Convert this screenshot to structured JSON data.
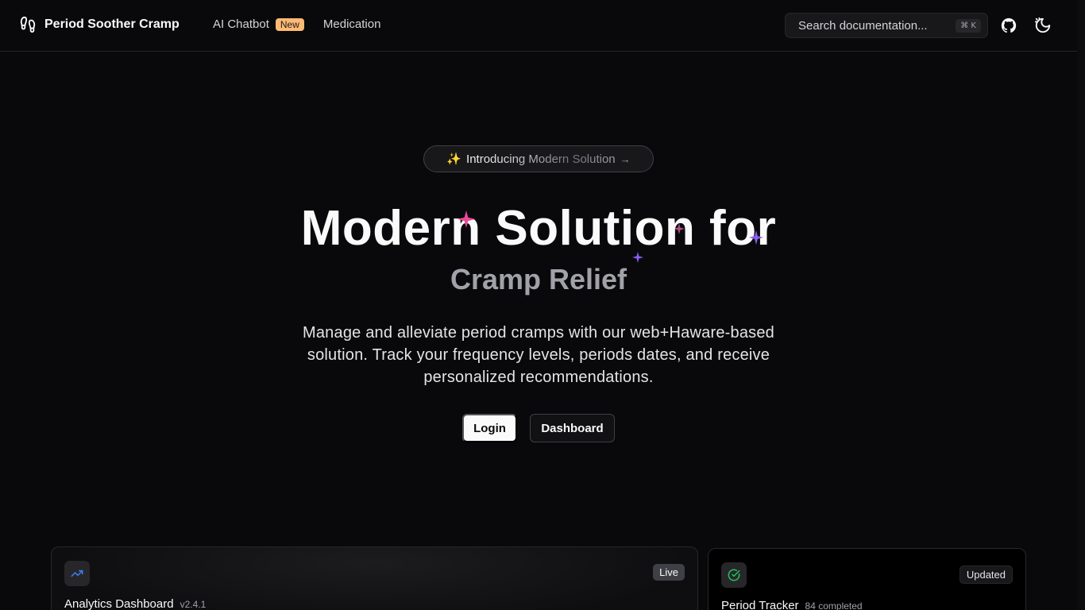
{
  "header": {
    "brand": "Period Soother Cramp",
    "nav": [
      {
        "label": "AI Chatbot",
        "badge": "New"
      },
      {
        "label": "Medication"
      }
    ],
    "search": {
      "placeholder": "Search documentation...",
      "shortcut": "⌘ K"
    },
    "icons": [
      "github-icon",
      "theme-toggle-icon"
    ]
  },
  "hero": {
    "announcement": {
      "emoji": "✨",
      "text": "Introducing Modern Solution",
      "arrow": "→"
    },
    "title": "Modern Solution for",
    "subtitle": "Cramp Relief",
    "description": "Manage and alleviate period cramps with our web+Haware-based solution. Track your frequency levels, periods dates, and receive personalized recommendations.",
    "buttons": {
      "login": "Login",
      "dashboard": "Dashboard"
    }
  },
  "cards": [
    {
      "title": "Analytics Dashboard",
      "meta": "v2.4.1",
      "tag": "Live",
      "icon": "trend-up-icon"
    },
    {
      "title": "Period Tracker",
      "meta": "84 completed",
      "tag": "Updated",
      "icon": "check-circle-icon"
    }
  ],
  "colors": {
    "background": "#09090b",
    "badge": "#fdba74",
    "accent_blue": "#3b82f6",
    "accent_green": "#22c55e",
    "sparkle_pink": "#ec4899",
    "sparkle_purple": "#8b5cf6"
  }
}
